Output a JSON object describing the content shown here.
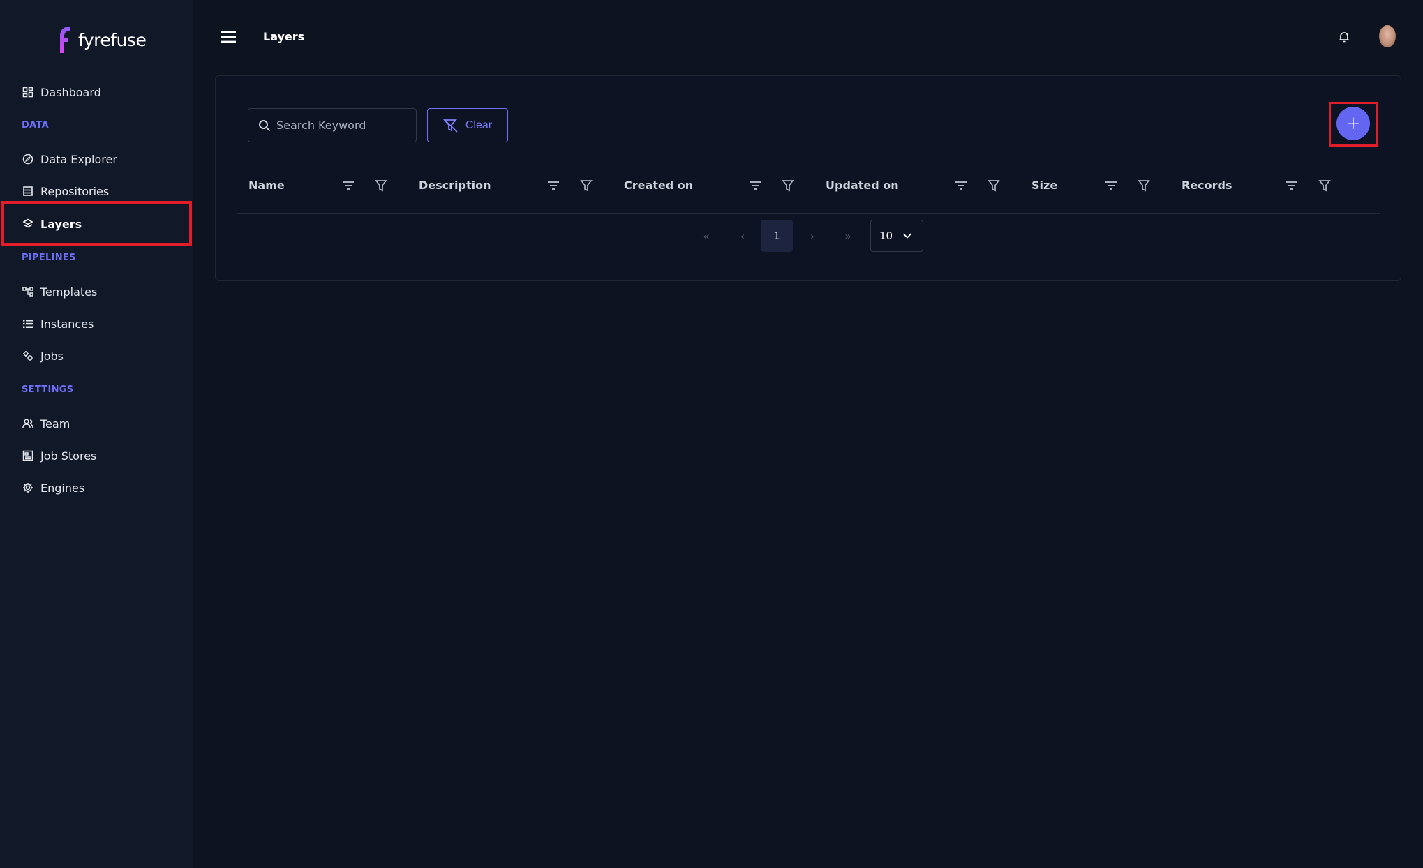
{
  "app": {
    "name": "fyrefuse"
  },
  "sidebar": {
    "items": [
      {
        "label": "Dashboard",
        "icon": "dashboard-icon"
      },
      {
        "label": "Data Explorer",
        "icon": "compass-icon"
      },
      {
        "label": "Repositories",
        "icon": "repository-icon"
      },
      {
        "label": "Layers",
        "icon": "layers-icon",
        "active": true
      },
      {
        "label": "Templates",
        "icon": "templates-icon"
      },
      {
        "label": "Instances",
        "icon": "list-icon"
      },
      {
        "label": "Jobs",
        "icon": "gears-icon"
      },
      {
        "label": "Team",
        "icon": "team-icon"
      },
      {
        "label": "Job Stores",
        "icon": "job-store-icon"
      },
      {
        "label": "Engines",
        "icon": "engine-gear-icon"
      }
    ],
    "sections": {
      "data": "DATA",
      "pipelines": "PIPELINES",
      "settings": "SETTINGS"
    }
  },
  "header": {
    "title": "Layers"
  },
  "toolbar": {
    "search_placeholder": "Search Keyword",
    "search_value": "",
    "clear_label": "Clear",
    "add_label": "+"
  },
  "table": {
    "columns": [
      "Name",
      "Description",
      "Created on",
      "Updated on",
      "Size",
      "Records"
    ],
    "rows": []
  },
  "pagination": {
    "first": "«",
    "prev": "‹",
    "current_page": "1",
    "next": "›",
    "last": "»",
    "page_size": "10"
  },
  "colors": {
    "accent": "#6366f1",
    "highlight_border": "#e11d2a",
    "background": "#0e1320",
    "sidebar_bg": "#111827"
  }
}
